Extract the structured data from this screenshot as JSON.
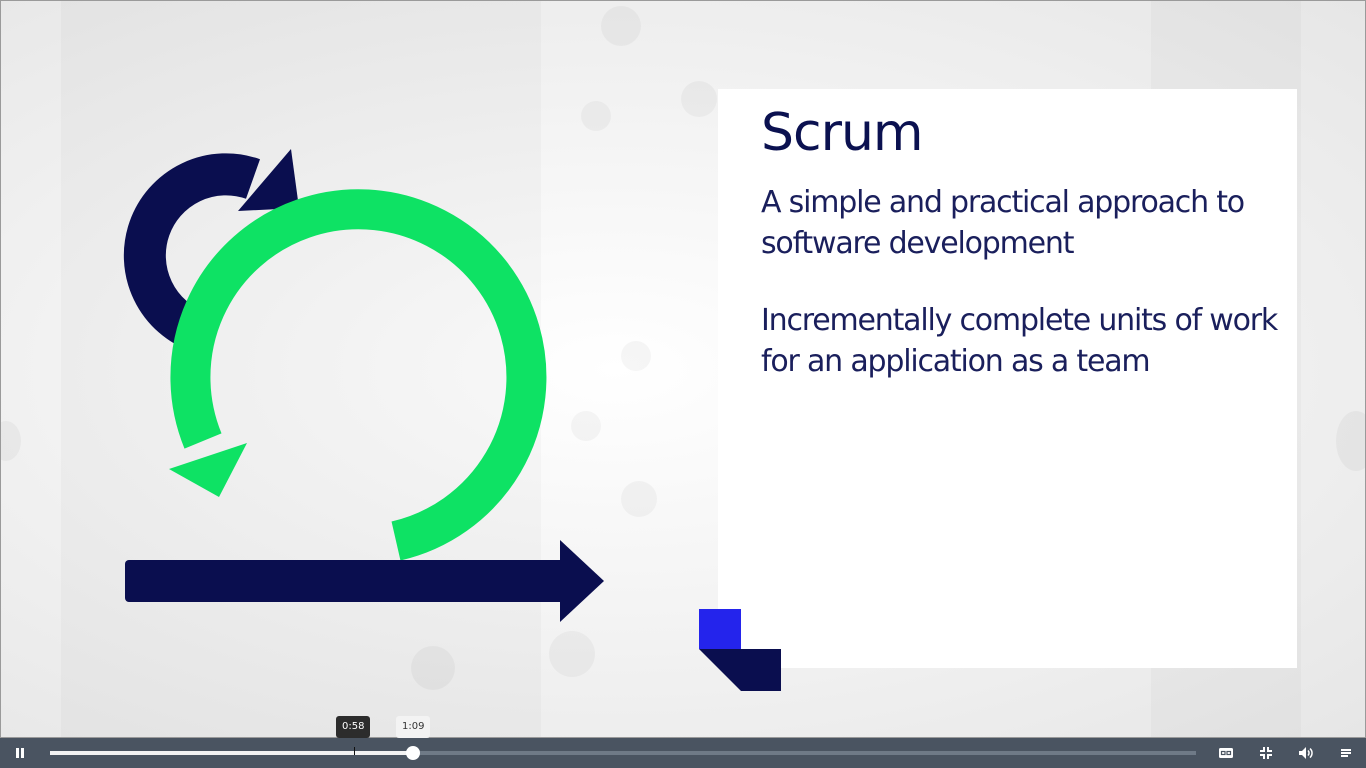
{
  "slide": {
    "title": "Scrum",
    "paragraphs": [
      "A simple and practical approach to software development",
      "Incrementally complete units of work for an application as a team"
    ]
  },
  "colors": {
    "navy": "#0a0e4f",
    "green": "#0ee264",
    "blue": "#2424ec",
    "controls_bg": "#4a5461"
  },
  "player": {
    "hover_time": "0:58",
    "current_time": "1:09",
    "progress_played_fraction": 0.317,
    "progress_hover_fraction": 0.265,
    "icons": {
      "play_pause": "pause-icon",
      "captions": "closed-captions-icon",
      "fullscreen": "exit-fullscreen-icon",
      "volume": "volume-icon",
      "transcript": "transcript-list-icon"
    }
  }
}
